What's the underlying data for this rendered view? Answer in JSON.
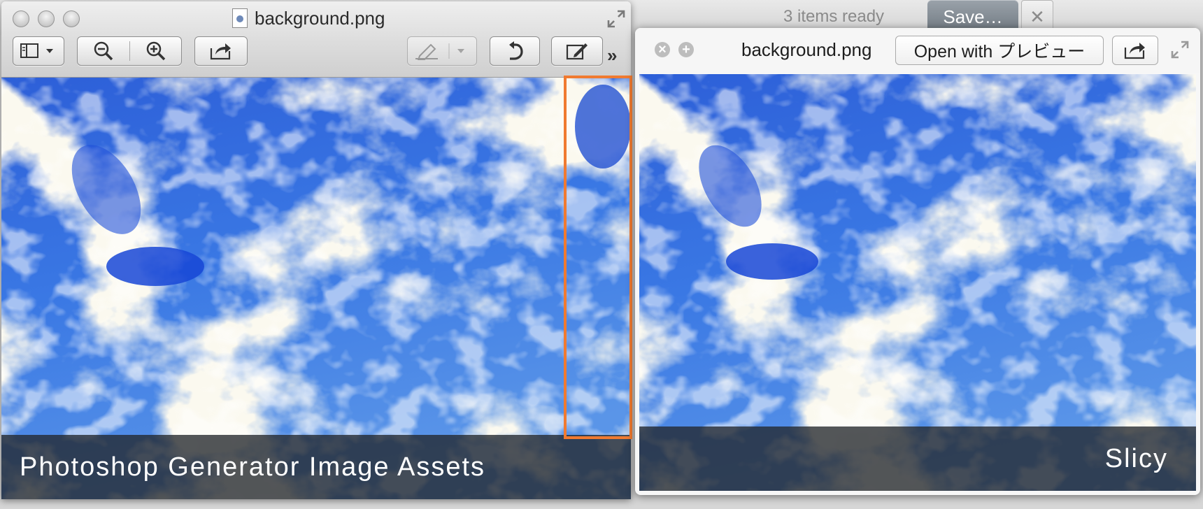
{
  "background_app": {
    "status_text": "3 items ready",
    "save_label": "Save…",
    "close_label": "✕"
  },
  "left_window": {
    "title": "background.png",
    "toolbar": {
      "buttons": [
        "sidebar-view",
        "zoom-out",
        "zoom-in",
        "share",
        "highlight",
        "rotate",
        "edit"
      ],
      "overflow": "»"
    },
    "caption": "Photoshop Generator Image Assets"
  },
  "right_window": {
    "title": "background.png",
    "open_with_label": "Open with プレビュー",
    "caption": "Slicy"
  },
  "colors": {
    "highlight_box": "#f07a30",
    "sky_blue": "#1f55d6",
    "caption_bg": "#23262c"
  },
  "icons": [
    "close-icon",
    "minimize-icon",
    "zoom-icon",
    "document-icon",
    "fullscreen-icon",
    "sidebar-icon",
    "zoom-out-icon",
    "zoom-in-icon",
    "share-icon",
    "highlight-icon",
    "rotate-icon",
    "edit-icon",
    "add-icon"
  ]
}
